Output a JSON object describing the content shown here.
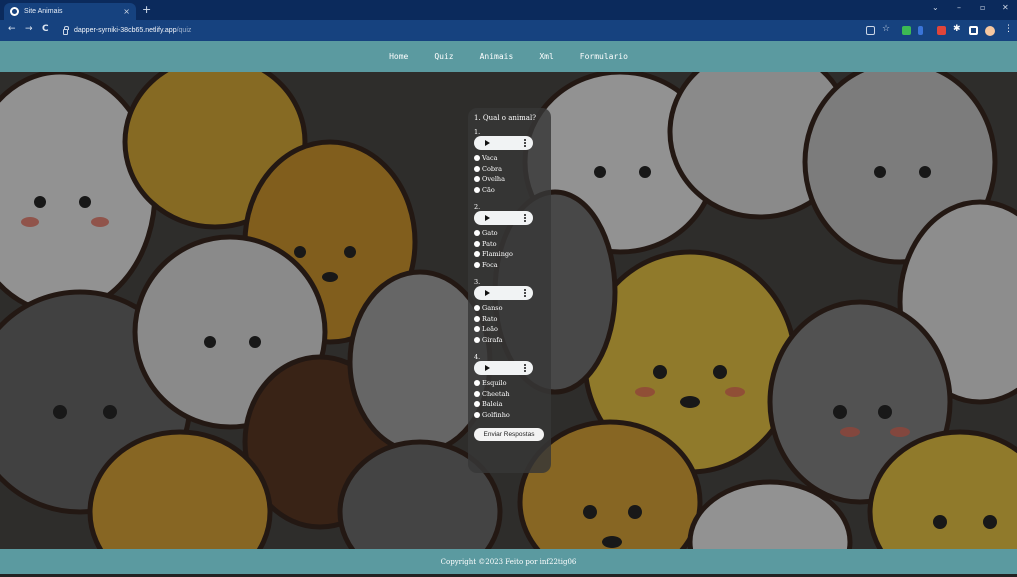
{
  "browser": {
    "tab_title": "Site Animais",
    "tab_close": "×",
    "new_tab": "+",
    "url_host": "dapper-syrniki-38cb65.netlify.app",
    "url_path": "/quiz",
    "back": "←",
    "forward": "→",
    "reload": "C",
    "minimize": "–",
    "restore": "▫",
    "close": "✕",
    "collapse": "⌄"
  },
  "nav": {
    "items": [
      {
        "label": "Home"
      },
      {
        "label": "Quiz"
      },
      {
        "label": "Animais"
      },
      {
        "label": "Xml"
      },
      {
        "label": "Formulario"
      }
    ]
  },
  "quiz": {
    "title": "1. Qual o animal?",
    "questions": [
      {
        "number": "1.",
        "options": [
          "Vaca",
          "Cobra",
          "Ovelha",
          "Cão"
        ]
      },
      {
        "number": "2.",
        "options": [
          "Gato",
          "Pato",
          "Flamingo",
          "Foca"
        ]
      },
      {
        "number": "3.",
        "options": [
          "Ganso",
          "Rato",
          "Leão",
          "Girafa"
        ]
      },
      {
        "number": "4.",
        "options": [
          "Esquilo",
          "Cheetah",
          "Baleia",
          "Golfinho"
        ]
      }
    ],
    "submit_label": "Enviar Respostas"
  },
  "footer": {
    "text": "Copyright ©2023 Feito por inf22tig06"
  },
  "colors": {
    "chrome_dark": "#0b2a5c",
    "chrome": "#16427f",
    "site_bar": "#5b9aa0",
    "quiz_panel": "#373737"
  }
}
